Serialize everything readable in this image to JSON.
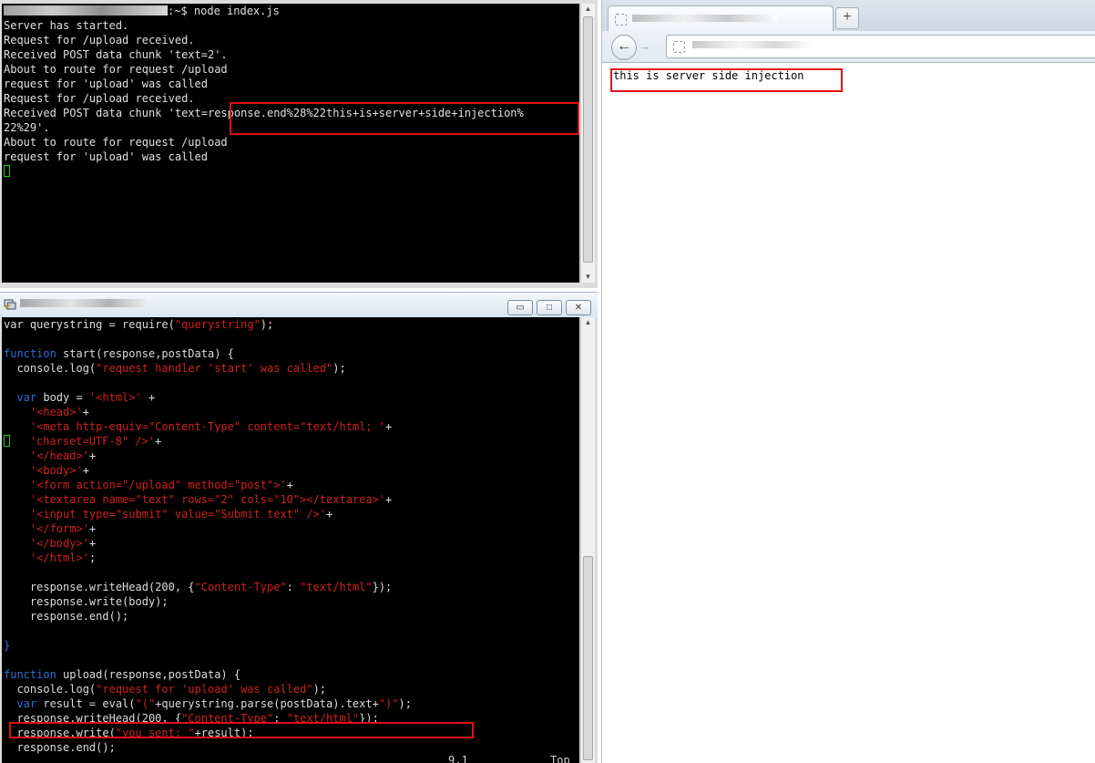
{
  "terminal_top": {
    "prompt_line": ":~$ node index.js",
    "lines": [
      "Server has started.",
      "Request for /upload received.",
      "Received POST data chunk 'text=2'.",
      "About to route for request /upload",
      "request for 'upload' was called",
      "Request for /upload received.",
      "Received POST data chunk 'text=response.end%28%22this+is+server+side+injection%",
      "22%29'.",
      "About to route for request /upload",
      "request for 'upload' was called"
    ]
  },
  "editor": {
    "window_buttons": {
      "minimize": "▭",
      "maximize": "□",
      "close": "✕"
    },
    "status_position": "9,1",
    "status_scroll": "Top",
    "code": {
      "l1_a": "var querystring = require(",
      "l1_s": "\"querystring\"",
      "l1_b": ");",
      "l3_kw": "function",
      "l3_b": " start(response,postData) {",
      "l4_a": "  console.log(",
      "l4_s": "\"request handler 'start' was called\"",
      "l4_b": ");",
      "l6_kw": "  var",
      "l6_b": " body = ",
      "l6_s": "'<html>'",
      "l6_c": " +",
      "l7_s": "'<head>'",
      "l8_s": "'<meta http-equiv=\"Content-Type\" content=\"text/html; '",
      "l9_s": "'charset=UTF-8\" />'",
      "l10_s": "'</head>'",
      "l11_s": "'<body>'",
      "l12_s": "'<form action=\"/upload\" method=\"post\">'",
      "l13_s": "'<textarea name=\"text\" rows=\"2\" cols=\"10\"></textarea>'",
      "l14_s": "'<input type=\"submit\" value=\"Submit text\" />'",
      "l15_s": "'</form>'",
      "l16_s": "'</body>'",
      "l17_s": "'</html>'",
      "plus": "+",
      "semi": ";",
      "l19_a": "    response.writeHead(200, {",
      "l19_s1": "\"Content-Type\"",
      "l19_colon": ": ",
      "l19_s2": "\"text/html\"",
      "l19_b": "});",
      "l20": "    response.write(body);",
      "l21": "    response.end();",
      "l23": "}",
      "l25_kw": "function",
      "l25_b": " upload(response,postData) {",
      "l26_a": "  console.log(",
      "l26_s": "\"request for 'upload' was called\"",
      "l26_b": ");",
      "l27_kw": "  var",
      "l27_b": " result = eval(",
      "l27_s1": "\"(\"",
      "l27_c": "+querystring.parse(postData).text+",
      "l27_s2": "\")\"",
      "l27_d": ");",
      "l28_a": "  response.writeHead(200, {",
      "l28_s1": "\"Content-Type\"",
      "l28_colon": ": ",
      "l28_s2": "\"text/html\"",
      "l28_b": "});",
      "l29_a": "  response.write(",
      "l29_s": "\"you sent: \"",
      "l29_b": "+result);",
      "l30": "  response.end();"
    }
  },
  "browser": {
    "new_tab_label": "+",
    "back_glyph": "←",
    "forward_glyph": "→",
    "page_text": "this is server side injection"
  },
  "colors": {
    "highlight": "#e01010",
    "keyword": "#2f6fd6",
    "string": "#d02020"
  }
}
